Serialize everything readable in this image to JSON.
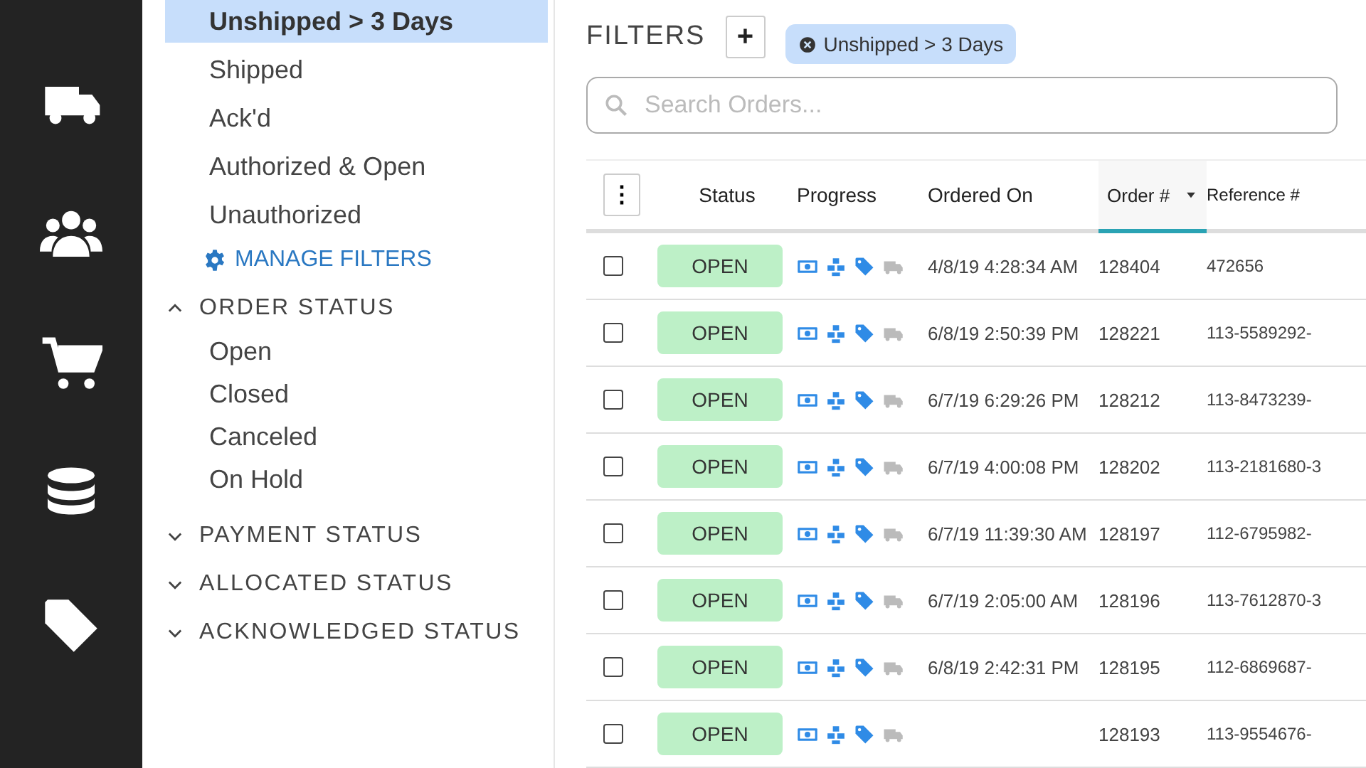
{
  "rail": [
    {
      "kind": "truck",
      "selected": false
    },
    {
      "kind": "people",
      "selected": false
    },
    {
      "kind": "cart",
      "selected": false
    },
    {
      "kind": "database",
      "selected": false
    },
    {
      "kind": "tag",
      "selected": false
    }
  ],
  "sidebar": {
    "saved_filters": [
      {
        "label": "Unshipped > 3 Days",
        "selected": true
      },
      {
        "label": "Shipped",
        "selected": false
      },
      {
        "label": "Ack'd",
        "selected": false
      },
      {
        "label": "Authorized & Open",
        "selected": false
      },
      {
        "label": "Unauthorized",
        "selected": false
      }
    ],
    "manage_filters": "MANAGE FILTERS",
    "sections": [
      {
        "title": "ORDER STATUS",
        "expanded": true,
        "items": [
          "Open",
          "Closed",
          "Canceled",
          "On Hold"
        ]
      },
      {
        "title": "PAYMENT STATUS",
        "expanded": false
      },
      {
        "title": "ALLOCATED STATUS",
        "expanded": false
      },
      {
        "title": "ACKNOWLEDGED STATUS",
        "expanded": false
      }
    ]
  },
  "filters": {
    "title": "FILTERS",
    "add": "+",
    "chips": [
      "Unshipped > 3 Days"
    ]
  },
  "search": {
    "placeholder": "Search Orders..."
  },
  "table": {
    "menu": "⋮",
    "columns": [
      {
        "label": "Status",
        "sorted": false
      },
      {
        "label": "Progress",
        "sorted": false
      },
      {
        "label": "Ordered On",
        "sorted": false
      },
      {
        "label": "Order #",
        "sorted": true
      },
      {
        "label": "Reference #",
        "sorted": false
      }
    ],
    "rows": [
      {
        "checked": false,
        "status": "OPEN",
        "progress": [
          {
            "kind": "money",
            "done": true
          },
          {
            "kind": "boxes",
            "done": true
          },
          {
            "kind": "tag",
            "done": true
          },
          {
            "kind": "truck",
            "done": false
          }
        ],
        "ordered_on": "4/8/19 4:28:34 AM",
        "order": "128404",
        "reference": "472656"
      },
      {
        "checked": false,
        "status": "OPEN",
        "progress": [
          {
            "kind": "money",
            "done": true
          },
          {
            "kind": "boxes",
            "done": true
          },
          {
            "kind": "tag",
            "done": true
          },
          {
            "kind": "truck",
            "done": false
          }
        ],
        "ordered_on": "6/8/19 2:50:39 PM",
        "order": "128221",
        "reference": "113-5589292-"
      },
      {
        "checked": false,
        "status": "OPEN",
        "progress": [
          {
            "kind": "money",
            "done": true
          },
          {
            "kind": "boxes",
            "done": true
          },
          {
            "kind": "tag",
            "done": true
          },
          {
            "kind": "truck",
            "done": false
          }
        ],
        "ordered_on": "6/7/19 6:29:26 PM",
        "order": "128212",
        "reference": "113-8473239-"
      },
      {
        "checked": false,
        "status": "OPEN",
        "progress": [
          {
            "kind": "money",
            "done": true
          },
          {
            "kind": "boxes",
            "done": true
          },
          {
            "kind": "tag",
            "done": true
          },
          {
            "kind": "truck",
            "done": false
          }
        ],
        "ordered_on": "6/7/19 4:00:08 PM",
        "order": "128202",
        "reference": "113-2181680-3"
      },
      {
        "checked": false,
        "status": "OPEN",
        "progress": [
          {
            "kind": "money",
            "done": true
          },
          {
            "kind": "boxes",
            "done": true
          },
          {
            "kind": "tag",
            "done": true
          },
          {
            "kind": "truck",
            "done": false
          }
        ],
        "ordered_on": "6/7/19 11:39:30 AM",
        "order": "128197",
        "reference": "112-6795982-"
      },
      {
        "checked": false,
        "status": "OPEN",
        "progress": [
          {
            "kind": "money",
            "done": true
          },
          {
            "kind": "boxes",
            "done": true
          },
          {
            "kind": "tag",
            "done": true
          },
          {
            "kind": "truck",
            "done": false
          }
        ],
        "ordered_on": "6/7/19 2:05:00 AM",
        "order": "128196",
        "reference": "113-7612870-3"
      },
      {
        "checked": false,
        "status": "OPEN",
        "progress": [
          {
            "kind": "money",
            "done": true
          },
          {
            "kind": "boxes",
            "done": true
          },
          {
            "kind": "tag",
            "done": true
          },
          {
            "kind": "truck",
            "done": false
          }
        ],
        "ordered_on": "6/8/19 2:42:31 PM",
        "order": "128195",
        "reference": "112-6869687-"
      },
      {
        "checked": false,
        "status": "OPEN",
        "progress": [
          {
            "kind": "money",
            "done": true
          },
          {
            "kind": "boxes",
            "done": true
          },
          {
            "kind": "tag",
            "done": true
          },
          {
            "kind": "truck",
            "done": false
          }
        ],
        "order": "128193",
        "reference": "113-9554676-"
      }
    ]
  }
}
